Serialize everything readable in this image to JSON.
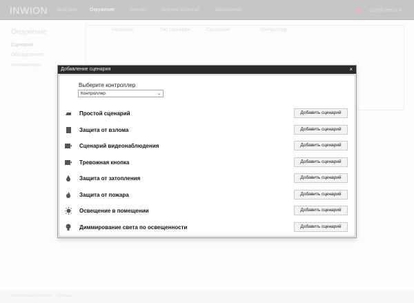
{
  "header": {
    "logo": "INWION",
    "nav": [
      "Мой дом",
      "Окружение",
      "Аналит",
      "Журнал событий",
      "Видеозапис"
    ],
    "user": "user@user.ru ▾"
  },
  "sidebar": {
    "title": "Окружение",
    "items": [
      "Сценарии",
      "Оборудование",
      "Контроллеры"
    ]
  },
  "table": {
    "headers": [
      "Название",
      "Тип сценария",
      "Состояние",
      "Контроллер"
    ]
  },
  "footer": {
    "links": [
      "Шаблонные решения",
      "Помощь"
    ]
  },
  "modal": {
    "title": "Добавление сценария",
    "close": "×",
    "controller_label": "Выберите контроллер",
    "controller_value": "Контроллер",
    "scenarios": [
      {
        "icon": "iron-icon",
        "label": "Простой сценарий"
      },
      {
        "icon": "shield-icon",
        "label": "Защита от взлома"
      },
      {
        "icon": "camera-icon",
        "label": "Сценарий видеонаблюдения"
      },
      {
        "icon": "camera-icon",
        "label": "Тревожная кнопка"
      },
      {
        "icon": "drop-icon",
        "label": "Защита от затопления"
      },
      {
        "icon": "fire-icon",
        "label": "Защита от пожара"
      },
      {
        "icon": "sun-icon",
        "label": "Освещение в помещении"
      },
      {
        "icon": "bulb-icon",
        "label": "Диммирование света по освещенности"
      }
    ],
    "add_label": "Добавить сценарий"
  }
}
